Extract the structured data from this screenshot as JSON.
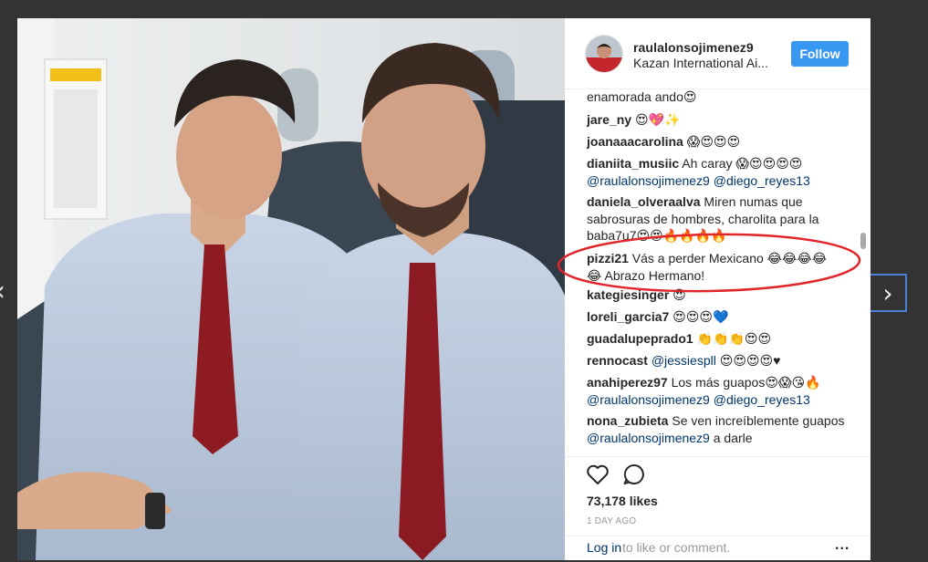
{
  "post": {
    "username": "raulalonsojimenez9",
    "location": "Kazan International Ai...",
    "follow_label": "Follow",
    "likes": "73,178 likes",
    "time_ago": "1 DAY AGO",
    "login_link": "Log in",
    "login_rest": "to like or comment.",
    "more_label": "..."
  },
  "comments": [
    {
      "text": "enamorada ando",
      "emoji": "😍"
    },
    {
      "user": "jare_ny",
      "emoji": "😍💖✨"
    },
    {
      "user": "joanaaacarolina",
      "emoji": "😱😍😍😍"
    },
    {
      "user": "dianiita_musiic",
      "text": "Ah caray",
      "emoji": "😱😍😍😍😍",
      "mention1": "@raulalonsojimenez9",
      "mention2": "@diego_reyes13"
    },
    {
      "user": "daniela_olveraalva",
      "text": "Miren numas que sabrosuras de hombres, charolita para la baba7u7",
      "emoji": "😍😍🔥🔥🔥🔥"
    },
    {
      "user": "pizzi21",
      "text": "Vás a perder Mexicano",
      "emoji": "😂😂😂😂",
      "emoji2": "😂",
      "text2": "Abrazo Hermano!"
    },
    {
      "user": "kategiesinger",
      "emoji": "😍"
    },
    {
      "user": "loreli_garcia7",
      "emoji": "😍😍😍💙"
    },
    {
      "user": "guadalupeprado1",
      "emoji": "👏👏👏😍😍"
    },
    {
      "user": "rennocast",
      "mention1": "@jessiespll",
      "emoji": "😍😍😍😍♥"
    },
    {
      "user": "anahiperez97",
      "text": "Los más guapos",
      "emoji": "😍😱😘🔥",
      "mention1": "@raulalonsojimenez9",
      "mention2": "@diego_reyes13"
    },
    {
      "user": "nona_zubieta",
      "text": "Se ven increíblemente guapos",
      "mention1": "@raulalonsojimenez9",
      "text3": "a darle"
    }
  ],
  "icons": {
    "heart": "heart-icon",
    "comment": "comment-icon",
    "left_arrow": "chevron-left-icon",
    "right_arrow": "chevron-right-icon"
  },
  "colors": {
    "follow": "#3897f0",
    "link": "#003569",
    "circle": "#e0262b"
  }
}
